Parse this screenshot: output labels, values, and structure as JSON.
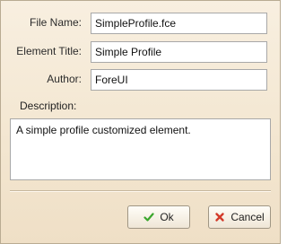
{
  "form": {
    "file_name_label": "File Name:",
    "file_name_value": "SimpleProfile.fce",
    "element_title_label": "Element Title:",
    "element_title_value": "Simple Profile",
    "author_label": "Author:",
    "author_value": "ForeUI",
    "description_label": "Description:",
    "description_value": "A simple profile customized element."
  },
  "buttons": {
    "ok_label": "Ok",
    "cancel_label": "Cancel"
  },
  "icons": {
    "ok": "checkmark-icon",
    "cancel": "close-icon"
  },
  "colors": {
    "background": "#f3e6d0",
    "ok_icon": "#3aa62c",
    "cancel_icon": "#d33a2a"
  }
}
